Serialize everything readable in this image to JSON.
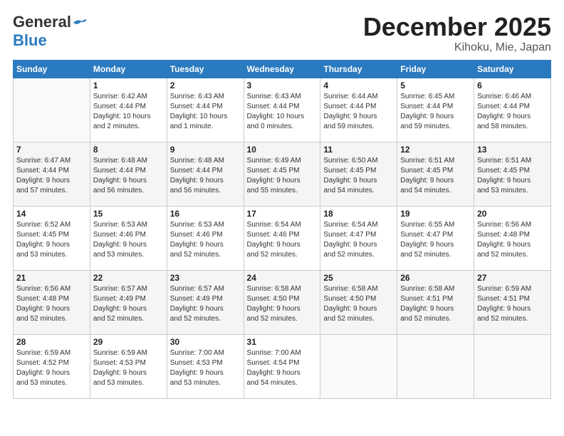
{
  "logo": {
    "general": "General",
    "blue": "Blue"
  },
  "title": "December 2025",
  "subtitle": "Kihoku, Mie, Japan",
  "header_days": [
    "Sunday",
    "Monday",
    "Tuesday",
    "Wednesday",
    "Thursday",
    "Friday",
    "Saturday"
  ],
  "weeks": [
    [
      {
        "date": "",
        "info": ""
      },
      {
        "date": "1",
        "info": "Sunrise: 6:42 AM\nSunset: 4:44 PM\nDaylight: 10 hours\nand 2 minutes."
      },
      {
        "date": "2",
        "info": "Sunrise: 6:43 AM\nSunset: 4:44 PM\nDaylight: 10 hours\nand 1 minute."
      },
      {
        "date": "3",
        "info": "Sunrise: 6:43 AM\nSunset: 4:44 PM\nDaylight: 10 hours\nand 0 minutes."
      },
      {
        "date": "4",
        "info": "Sunrise: 6:44 AM\nSunset: 4:44 PM\nDaylight: 9 hours\nand 59 minutes."
      },
      {
        "date": "5",
        "info": "Sunrise: 6:45 AM\nSunset: 4:44 PM\nDaylight: 9 hours\nand 59 minutes."
      },
      {
        "date": "6",
        "info": "Sunrise: 6:46 AM\nSunset: 4:44 PM\nDaylight: 9 hours\nand 58 minutes."
      }
    ],
    [
      {
        "date": "7",
        "info": "Sunrise: 6:47 AM\nSunset: 4:44 PM\nDaylight: 9 hours\nand 57 minutes."
      },
      {
        "date": "8",
        "info": "Sunrise: 6:48 AM\nSunset: 4:44 PM\nDaylight: 9 hours\nand 56 minutes."
      },
      {
        "date": "9",
        "info": "Sunrise: 6:48 AM\nSunset: 4:44 PM\nDaylight: 9 hours\nand 56 minutes."
      },
      {
        "date": "10",
        "info": "Sunrise: 6:49 AM\nSunset: 4:45 PM\nDaylight: 9 hours\nand 55 minutes."
      },
      {
        "date": "11",
        "info": "Sunrise: 6:50 AM\nSunset: 4:45 PM\nDaylight: 9 hours\nand 54 minutes."
      },
      {
        "date": "12",
        "info": "Sunrise: 6:51 AM\nSunset: 4:45 PM\nDaylight: 9 hours\nand 54 minutes."
      },
      {
        "date": "13",
        "info": "Sunrise: 6:51 AM\nSunset: 4:45 PM\nDaylight: 9 hours\nand 53 minutes."
      }
    ],
    [
      {
        "date": "14",
        "info": "Sunrise: 6:52 AM\nSunset: 4:45 PM\nDaylight: 9 hours\nand 53 minutes."
      },
      {
        "date": "15",
        "info": "Sunrise: 6:53 AM\nSunset: 4:46 PM\nDaylight: 9 hours\nand 53 minutes."
      },
      {
        "date": "16",
        "info": "Sunrise: 6:53 AM\nSunset: 4:46 PM\nDaylight: 9 hours\nand 52 minutes."
      },
      {
        "date": "17",
        "info": "Sunrise: 6:54 AM\nSunset: 4:46 PM\nDaylight: 9 hours\nand 52 minutes."
      },
      {
        "date": "18",
        "info": "Sunrise: 6:54 AM\nSunset: 4:47 PM\nDaylight: 9 hours\nand 52 minutes."
      },
      {
        "date": "19",
        "info": "Sunrise: 6:55 AM\nSunset: 4:47 PM\nDaylight: 9 hours\nand 52 minutes."
      },
      {
        "date": "20",
        "info": "Sunrise: 6:56 AM\nSunset: 4:48 PM\nDaylight: 9 hours\nand 52 minutes."
      }
    ],
    [
      {
        "date": "21",
        "info": "Sunrise: 6:56 AM\nSunset: 4:48 PM\nDaylight: 9 hours\nand 52 minutes."
      },
      {
        "date": "22",
        "info": "Sunrise: 6:57 AM\nSunset: 4:49 PM\nDaylight: 9 hours\nand 52 minutes."
      },
      {
        "date": "23",
        "info": "Sunrise: 6:57 AM\nSunset: 4:49 PM\nDaylight: 9 hours\nand 52 minutes."
      },
      {
        "date": "24",
        "info": "Sunrise: 6:58 AM\nSunset: 4:50 PM\nDaylight: 9 hours\nand 52 minutes."
      },
      {
        "date": "25",
        "info": "Sunrise: 6:58 AM\nSunset: 4:50 PM\nDaylight: 9 hours\nand 52 minutes."
      },
      {
        "date": "26",
        "info": "Sunrise: 6:58 AM\nSunset: 4:51 PM\nDaylight: 9 hours\nand 52 minutes."
      },
      {
        "date": "27",
        "info": "Sunrise: 6:59 AM\nSunset: 4:51 PM\nDaylight: 9 hours\nand 52 minutes."
      }
    ],
    [
      {
        "date": "28",
        "info": "Sunrise: 6:59 AM\nSunset: 4:52 PM\nDaylight: 9 hours\nand 53 minutes."
      },
      {
        "date": "29",
        "info": "Sunrise: 6:59 AM\nSunset: 4:53 PM\nDaylight: 9 hours\nand 53 minutes."
      },
      {
        "date": "30",
        "info": "Sunrise: 7:00 AM\nSunset: 4:53 PM\nDaylight: 9 hours\nand 53 minutes."
      },
      {
        "date": "31",
        "info": "Sunrise: 7:00 AM\nSunset: 4:54 PM\nDaylight: 9 hours\nand 54 minutes."
      },
      {
        "date": "",
        "info": ""
      },
      {
        "date": "",
        "info": ""
      },
      {
        "date": "",
        "info": ""
      }
    ]
  ]
}
